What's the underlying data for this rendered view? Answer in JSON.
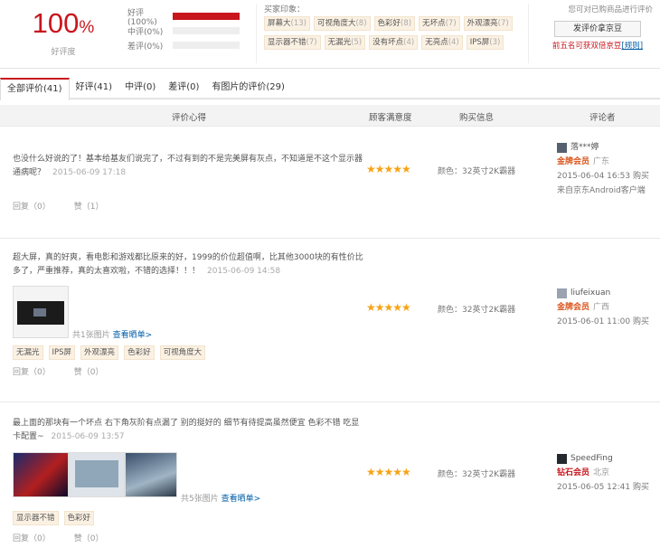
{
  "summary": {
    "rate_value": "100",
    "rate_unit": "%",
    "rate_label": "好评度",
    "bars": [
      {
        "label": "好评(100%)",
        "fill_pct": 100
      },
      {
        "label": "中评(0%)",
        "fill_pct": 0
      },
      {
        "label": "差评(0%)",
        "fill_pct": 0
      }
    ],
    "impression_title": "买家印象：",
    "impressions": [
      {
        "label": "屏幕大",
        "count": "(13)"
      },
      {
        "label": "可视角度大",
        "count": "(8)"
      },
      {
        "label": "色彩好",
        "count": "(8)"
      },
      {
        "label": "无坏点",
        "count": "(7)"
      },
      {
        "label": "外观漂亮",
        "count": "(7)"
      },
      {
        "label": "显示器不错",
        "count": "(7)"
      },
      {
        "label": "无漏光",
        "count": "(5)"
      },
      {
        "label": "没有坏点",
        "count": "(4)"
      },
      {
        "label": "无亮点",
        "count": "(4)"
      },
      {
        "label": "IPS屏",
        "count": "(3)"
      }
    ],
    "action_tip": "您可对已购商品进行评价",
    "review_button": "发评价拿京豆",
    "action_note": "前五名可获双倍京豆",
    "action_link": "[规则]"
  },
  "tabs": [
    {
      "label": "全部评价(41)",
      "active": true
    },
    {
      "label": "好评(41)"
    },
    {
      "label": "中评(0)"
    },
    {
      "label": "差评(0)"
    },
    {
      "label": "有图片的评价(29)"
    }
  ],
  "columns": {
    "comment": "评价心得",
    "satisfaction": "顾客满意度",
    "purchase": "购买信息",
    "reviewer": "评论者"
  },
  "reviews": [
    {
      "text": "也没什么好说的了！基本给基友们说完了，不过有到的不是完美屏有灰点，不知道是不这个显示器通病呢？",
      "date": "2015-06-09 17:18",
      "stars": "★★★★★",
      "spec": "颜色：32英寸2K霸器",
      "user": "落***婷",
      "level": "金牌会员",
      "region": "广东",
      "buy_date": "2015-06-04 16:53 购买",
      "client": "来自京东Android客户端",
      "reply": "回复（0）",
      "like": "赞（1）"
    },
    {
      "text": "超大屏，真的好爽，看电影和游戏都比原来的好，1999的价位超值啊，比其他3000块的有性价比多了，严重推荐，真的太喜欢啦，不错的选择！！！",
      "date": "2015-06-09 14:58",
      "stars": "★★★★★",
      "spec": "颜色：32英寸2K霸器",
      "user": "liufeixuan",
      "level": "金牌会员",
      "region": "广西",
      "buy_date": "2015-06-01 11:00 购买",
      "pic_count": "共1张图片",
      "pic_link": "查看晒单>",
      "tags": [
        "无漏光",
        "IPS屏",
        "外观漂亮",
        "色彩好",
        "可视角度大"
      ],
      "reply": "回复（0）",
      "like": "赞（0）"
    },
    {
      "text": "最上面的那块有一个坏点 右下角灰阶有点漏了 别的挺好的 细节有待提高虽然便宜 色彩不错 吃显卡配置~",
      "date": "2015-06-09 13:57",
      "stars": "★★★★★",
      "spec": "颜色：32英寸2K霸器",
      "user": "SpeedFing",
      "level": "钻石会员",
      "region": "北京",
      "buy_date": "2015-06-05 12:41 购买",
      "pic_count": "共5张图片",
      "pic_link": "查看晒单>",
      "tags": [
        "显示器不错",
        "色彩好"
      ],
      "reply": "回复（0）",
      "like": "赞（0）"
    }
  ]
}
